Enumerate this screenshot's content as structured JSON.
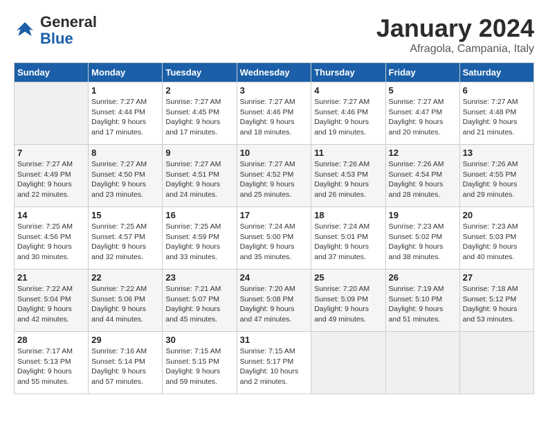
{
  "header": {
    "logo_line1": "General",
    "logo_line2": "Blue",
    "month": "January 2024",
    "location": "Afragola, Campania, Italy"
  },
  "columns": [
    "Sunday",
    "Monday",
    "Tuesday",
    "Wednesday",
    "Thursday",
    "Friday",
    "Saturday"
  ],
  "weeks": [
    [
      {
        "day": "",
        "empty": true
      },
      {
        "day": "1",
        "sunrise": "7:27 AM",
        "sunset": "4:44 PM",
        "daylight": "9 hours and 17 minutes."
      },
      {
        "day": "2",
        "sunrise": "7:27 AM",
        "sunset": "4:45 PM",
        "daylight": "9 hours and 17 minutes."
      },
      {
        "day": "3",
        "sunrise": "7:27 AM",
        "sunset": "4:46 PM",
        "daylight": "9 hours and 18 minutes."
      },
      {
        "day": "4",
        "sunrise": "7:27 AM",
        "sunset": "4:46 PM",
        "daylight": "9 hours and 19 minutes."
      },
      {
        "day": "5",
        "sunrise": "7:27 AM",
        "sunset": "4:47 PM",
        "daylight": "9 hours and 20 minutes."
      },
      {
        "day": "6",
        "sunrise": "7:27 AM",
        "sunset": "4:48 PM",
        "daylight": "9 hours and 21 minutes."
      }
    ],
    [
      {
        "day": "7",
        "sunrise": "7:27 AM",
        "sunset": "4:49 PM",
        "daylight": "9 hours and 22 minutes."
      },
      {
        "day": "8",
        "sunrise": "7:27 AM",
        "sunset": "4:50 PM",
        "daylight": "9 hours and 23 minutes."
      },
      {
        "day": "9",
        "sunrise": "7:27 AM",
        "sunset": "4:51 PM",
        "daylight": "9 hours and 24 minutes."
      },
      {
        "day": "10",
        "sunrise": "7:27 AM",
        "sunset": "4:52 PM",
        "daylight": "9 hours and 25 minutes."
      },
      {
        "day": "11",
        "sunrise": "7:26 AM",
        "sunset": "4:53 PM",
        "daylight": "9 hours and 26 minutes."
      },
      {
        "day": "12",
        "sunrise": "7:26 AM",
        "sunset": "4:54 PM",
        "daylight": "9 hours and 28 minutes."
      },
      {
        "day": "13",
        "sunrise": "7:26 AM",
        "sunset": "4:55 PM",
        "daylight": "9 hours and 29 minutes."
      }
    ],
    [
      {
        "day": "14",
        "sunrise": "7:25 AM",
        "sunset": "4:56 PM",
        "daylight": "9 hours and 30 minutes."
      },
      {
        "day": "15",
        "sunrise": "7:25 AM",
        "sunset": "4:57 PM",
        "daylight": "9 hours and 32 minutes."
      },
      {
        "day": "16",
        "sunrise": "7:25 AM",
        "sunset": "4:59 PM",
        "daylight": "9 hours and 33 minutes."
      },
      {
        "day": "17",
        "sunrise": "7:24 AM",
        "sunset": "5:00 PM",
        "daylight": "9 hours and 35 minutes."
      },
      {
        "day": "18",
        "sunrise": "7:24 AM",
        "sunset": "5:01 PM",
        "daylight": "9 hours and 37 minutes."
      },
      {
        "day": "19",
        "sunrise": "7:23 AM",
        "sunset": "5:02 PM",
        "daylight": "9 hours and 38 minutes."
      },
      {
        "day": "20",
        "sunrise": "7:23 AM",
        "sunset": "5:03 PM",
        "daylight": "9 hours and 40 minutes."
      }
    ],
    [
      {
        "day": "21",
        "sunrise": "7:22 AM",
        "sunset": "5:04 PM",
        "daylight": "9 hours and 42 minutes."
      },
      {
        "day": "22",
        "sunrise": "7:22 AM",
        "sunset": "5:06 PM",
        "daylight": "9 hours and 44 minutes."
      },
      {
        "day": "23",
        "sunrise": "7:21 AM",
        "sunset": "5:07 PM",
        "daylight": "9 hours and 45 minutes."
      },
      {
        "day": "24",
        "sunrise": "7:20 AM",
        "sunset": "5:08 PM",
        "daylight": "9 hours and 47 minutes."
      },
      {
        "day": "25",
        "sunrise": "7:20 AM",
        "sunset": "5:09 PM",
        "daylight": "9 hours and 49 minutes."
      },
      {
        "day": "26",
        "sunrise": "7:19 AM",
        "sunset": "5:10 PM",
        "daylight": "9 hours and 51 minutes."
      },
      {
        "day": "27",
        "sunrise": "7:18 AM",
        "sunset": "5:12 PM",
        "daylight": "9 hours and 53 minutes."
      }
    ],
    [
      {
        "day": "28",
        "sunrise": "7:17 AM",
        "sunset": "5:13 PM",
        "daylight": "9 hours and 55 minutes."
      },
      {
        "day": "29",
        "sunrise": "7:16 AM",
        "sunset": "5:14 PM",
        "daylight": "9 hours and 57 minutes."
      },
      {
        "day": "30",
        "sunrise": "7:15 AM",
        "sunset": "5:15 PM",
        "daylight": "9 hours and 59 minutes."
      },
      {
        "day": "31",
        "sunrise": "7:15 AM",
        "sunset": "5:17 PM",
        "daylight": "10 hours and 2 minutes."
      },
      {
        "day": "",
        "empty": true
      },
      {
        "day": "",
        "empty": true
      },
      {
        "day": "",
        "empty": true
      }
    ]
  ]
}
